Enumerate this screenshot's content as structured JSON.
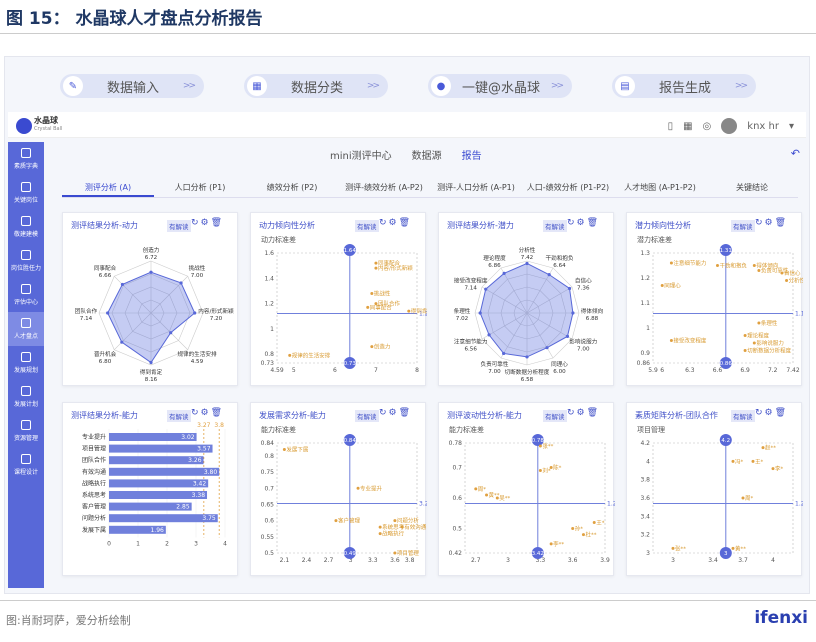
{
  "figure_title": "图 15： 水晶球人才盘点分析报告",
  "caption": "图:肖耐珂萨，爱分析绘制",
  "brand": "ifenxi",
  "actions": [
    {
      "label": "数据输入",
      "icon": "pen-icon"
    },
    {
      "label": "数据分类",
      "icon": "grid-icon"
    },
    {
      "label": "一键@水晶球",
      "icon": "crystal-ball-icon"
    },
    {
      "label": "报告生成",
      "icon": "report-icon"
    }
  ],
  "app": {
    "logo_name": "水晶球",
    "logo_en": "Crystal Ball",
    "user": "knx hr"
  },
  "sidebar": [
    "素质字典",
    "关键岗位",
    "敬建建模",
    "岗位胜任力",
    "评估中心",
    "人才盘点",
    "发展规划",
    "发展计划",
    "资源管理",
    "课程设计"
  ],
  "sidebar_active": 5,
  "subnav": [
    "mini测评中心",
    "数据源",
    "报告"
  ],
  "tabs": [
    "测评分析 (A)",
    "人口分析 (P1)",
    "绩效分析 (P2)",
    "测评-绩效分析 (A-P2)",
    "测评-人口分析 (A-P1)",
    "人口-绩效分析 (P1-P2)",
    "人才地图 (A-P1-P2)",
    "关键结论"
  ],
  "badge": "有解读",
  "cards": [
    {
      "title": "测评结果分析-动力"
    },
    {
      "title": "动力倾向性分析",
      "ylabel": "动力标准差"
    },
    {
      "title": "测评结果分析-潜力"
    },
    {
      "title": "潜力倾向性分析",
      "ylabel": "潜力标准差"
    },
    {
      "title": "测评结果分析-能力"
    },
    {
      "title": "发展需求分析-能力",
      "ylabel": "能力标准差"
    },
    {
      "title": "测评波动性分析-能力",
      "ylabel": "能力标准差"
    },
    {
      "title": "素质矩阵分析-团队合作",
      "ylabel": "项目管理"
    }
  ],
  "chart_data": [
    {
      "type": "radar",
      "title": "测评结果分析-动力",
      "categories": [
        "创造力",
        "挑战性",
        "内容/形式新颖",
        "规律的生活安排",
        "得到肯定",
        "晋升机会",
        "团队合作",
        "同事配合"
      ],
      "values": [
        6.72,
        7.0,
        7.2,
        4.59,
        8.16,
        6.8,
        7.14,
        6.66
      ]
    },
    {
      "type": "scatter",
      "title": "动力倾向性分析",
      "ylabel": "动力标准差",
      "ref_x": 1.64,
      "ref_y": 1.2,
      "xlim": [
        4.59,
        8
      ],
      "ylim": [
        0.73,
        1.6
      ],
      "xticks": [
        "4.59",
        "5",
        "6",
        "7",
        "8"
      ],
      "yticks": [
        "0.73",
        "0.8",
        "1",
        "1.2",
        "1.4",
        "1.6"
      ],
      "marker_top": "1.64",
      "marker_bottom": "0.73",
      "marker_right": "1.2",
      "points": [
        {
          "x": 7.0,
          "y": 1.52,
          "label": "同事配合"
        },
        {
          "x": 7.0,
          "y": 1.48,
          "label": "内容/形式新颖"
        },
        {
          "x": 6.9,
          "y": 1.28,
          "label": "挑战性"
        },
        {
          "x": 7.0,
          "y": 1.2,
          "label": "团队合作"
        },
        {
          "x": 6.8,
          "y": 1.17,
          "label": "同事配合"
        },
        {
          "x": 7.8,
          "y": 1.14,
          "label": "得到肯定"
        },
        {
          "x": 6.9,
          "y": 0.86,
          "label": "创造力"
        },
        {
          "x": 4.9,
          "y": 0.79,
          "label": "规律的生活安排"
        }
      ]
    },
    {
      "type": "radar",
      "title": "测评结果分析-潜力",
      "categories": [
        "分析性",
        "干劲和抱负",
        "自信心",
        "得体倾向",
        "影响说服力",
        "同理心",
        "切断数据分析程度",
        "负责可靠性",
        "注意细节能力",
        "条理性",
        "接受改变程度",
        "理论程度"
      ],
      "values": [
        7.42,
        6.64,
        7.36,
        6.88,
        7.0,
        6.0,
        6.58,
        7.0,
        6.56,
        7.02,
        7.14,
        6.86
      ]
    },
    {
      "type": "scatter",
      "title": "潜力倾向性分析",
      "ylabel": "潜力标准差",
      "ref_x": 6.81,
      "ref_y": 1.14,
      "xlim": [
        5.9,
        7.42
      ],
      "ylim": [
        0.86,
        1.3
      ],
      "xticks": [
        "5.9",
        "6",
        "6.3",
        "6.6",
        "6.9",
        "7.2",
        "7.42"
      ],
      "yticks": [
        "0.86",
        "0.9",
        "1",
        "1.1",
        "1.2",
        "1.3"
      ],
      "marker_top": "1.31",
      "marker_bottom": "0.86",
      "marker_right": "1.14",
      "points": [
        {
          "x": 6.1,
          "y": 1.26,
          "label": "注意细节能力"
        },
        {
          "x": 6.6,
          "y": 1.25,
          "label": "干劲和抱负"
        },
        {
          "x": 7.0,
          "y": 1.25,
          "label": "得体倾向"
        },
        {
          "x": 7.05,
          "y": 1.23,
          "label": "负责可靠性"
        },
        {
          "x": 7.3,
          "y": 1.22,
          "label": "自信心"
        },
        {
          "x": 7.35,
          "y": 1.19,
          "label": "分析性"
        },
        {
          "x": 6.0,
          "y": 1.17,
          "label": "同理心"
        },
        {
          "x": 7.05,
          "y": 1.02,
          "label": "条理性"
        },
        {
          "x": 6.9,
          "y": 0.97,
          "label": "理论程度"
        },
        {
          "x": 6.1,
          "y": 0.95,
          "label": "接受改变程度"
        },
        {
          "x": 7.0,
          "y": 0.94,
          "label": "影响说服力"
        },
        {
          "x": 6.9,
          "y": 0.91,
          "label": "切断数据分析程度"
        }
      ]
    },
    {
      "type": "bar",
      "title": "测评结果分析-能力",
      "categories": [
        "专业提升",
        "项目管理",
        "团队合作",
        "有效沟通",
        "战略执行",
        "系统思考",
        "客户管理",
        "问题分析",
        "发展下属"
      ],
      "values": [
        3.02,
        3.57,
        3.26,
        3.8,
        3.42,
        3.38,
        2.85,
        3.75,
        1.96
      ],
      "ref_values": [
        3.27,
        3.8
      ],
      "xlim": [
        0,
        4
      ],
      "xticks": [
        "0",
        "1",
        "2",
        "3",
        "4"
      ]
    },
    {
      "type": "scatter",
      "title": "发展需求分析-能力",
      "ylabel": "能力标准差",
      "ref_x": 3.24,
      "ref_y": 0.65,
      "xlim": [
        2.0,
        3.9
      ],
      "ylim": [
        0.5,
        0.84
      ],
      "xticks": [
        "2.1",
        "2.4",
        "2.7",
        "3",
        "3.3",
        "3.6",
        "3.8"
      ],
      "yticks": [
        "0.5",
        "0.55",
        "0.6",
        "0.65",
        "0.7",
        "0.75",
        "0.8",
        "0.84"
      ],
      "marker_top": "0.84",
      "marker_bottom": "0.49",
      "marker_right": "3.24",
      "points": [
        {
          "x": 2.1,
          "y": 0.82,
          "label": "发展下属"
        },
        {
          "x": 3.1,
          "y": 0.7,
          "label": "专业提升"
        },
        {
          "x": 2.8,
          "y": 0.6,
          "label": "客户管理"
        },
        {
          "x": 3.6,
          "y": 0.6,
          "label": "问题分析"
        },
        {
          "x": 3.7,
          "y": 0.58,
          "label": "有效沟通"
        },
        {
          "x": 3.4,
          "y": 0.58,
          "label": "系统思考"
        },
        {
          "x": 3.4,
          "y": 0.56,
          "label": "战略执行"
        },
        {
          "x": 3.6,
          "y": 0.5,
          "label": "项目管理"
        }
      ]
    },
    {
      "type": "scatter",
      "title": "测评波动性分析-能力",
      "ylabel": "能力标准差",
      "ref_x": 6.96,
      "ref_y": 0.78,
      "xlim": [
        2.6,
        3.9
      ],
      "ylim": [
        0.42,
        0.78
      ],
      "xticks": [
        "2.7",
        "3",
        "3.3",
        "3.6",
        "3.9"
      ],
      "yticks": [
        "0.42",
        "0.5",
        "0.6",
        "0.7",
        "0.78"
      ],
      "marker_top": "0.78",
      "marker_bottom": "3.42",
      "marker_right": "1.2",
      "points": [
        {
          "x": 3.3,
          "y": 0.77,
          "label": "张**"
        },
        {
          "x": 3.4,
          "y": 0.7,
          "label": "陈*"
        },
        {
          "x": 3.3,
          "y": 0.69,
          "label": "刘*"
        },
        {
          "x": 2.7,
          "y": 0.63,
          "label": "周*"
        },
        {
          "x": 2.8,
          "y": 0.61,
          "label": "黄**"
        },
        {
          "x": 2.9,
          "y": 0.6,
          "label": "吴**"
        },
        {
          "x": 3.8,
          "y": 0.52,
          "label": "王*"
        },
        {
          "x": 3.6,
          "y": 0.5,
          "label": "孙*"
        },
        {
          "x": 3.7,
          "y": 0.48,
          "label": "杜**"
        },
        {
          "x": 3.4,
          "y": 0.45,
          "label": "李**"
        }
      ]
    },
    {
      "type": "scatter",
      "title": "素质矩阵分析-团队合作",
      "ylabel": "项目管理",
      "ref_x": 6.96,
      "ref_y": 3.6,
      "xlim": [
        2.8,
        4.2
      ],
      "ylim": [
        3.0,
        4.2
      ],
      "xticks": [
        "3",
        "3.4",
        "3.7",
        "4"
      ],
      "yticks": [
        "3",
        "3.2",
        "3.4",
        "3.6",
        "3.8",
        "4",
        "4.2"
      ],
      "marker_top": "4.2",
      "marker_bottom": "3",
      "marker_right": "1.2",
      "points": [
        {
          "x": 3.9,
          "y": 4.15,
          "label": "赵**"
        },
        {
          "x": 3.6,
          "y": 4.0,
          "label": "冯*"
        },
        {
          "x": 3.8,
          "y": 4.0,
          "label": "王*"
        },
        {
          "x": 4.0,
          "y": 3.92,
          "label": "李*"
        },
        {
          "x": 3.7,
          "y": 3.6,
          "label": "周*"
        },
        {
          "x": 3.0,
          "y": 3.05,
          "label": "张**"
        },
        {
          "x": 3.6,
          "y": 3.05,
          "label": "黄**"
        }
      ]
    }
  ]
}
